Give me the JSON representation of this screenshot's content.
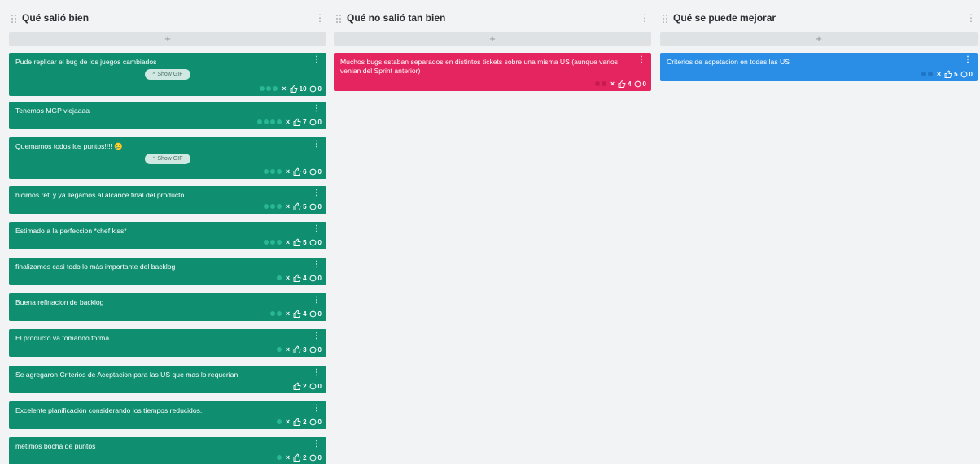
{
  "columns": [
    {
      "title": "Qué salió bien",
      "add_label": "+",
      "color": "#0f8f70",
      "cards": [
        {
          "text": "Pude replicar el bug de los juegos cambiados",
          "gif": "Show GIF",
          "dots": 3,
          "votes": "10",
          "comments": "0",
          "x": true
        },
        {
          "text": "Tenemos MGP viejaaaa",
          "dots": 4,
          "votes": "7",
          "comments": "0",
          "x": true
        },
        {
          "text": "Quemamos todos los puntos!!!! 🥲",
          "gif": "Show GIF",
          "dots": 3,
          "votes": "6",
          "comments": "0",
          "x": true
        },
        {
          "text": "hicimos refi y ya llegamos al alcance final del producto",
          "dots": 3,
          "votes": "5",
          "comments": "0",
          "x": true
        },
        {
          "text": "Estimado a la perfeccion *chef kiss*",
          "dots": 3,
          "votes": "5",
          "comments": "0",
          "x": true
        },
        {
          "text": "finalizamos casi todo lo más importante del backlog",
          "dots": 1,
          "votes": "4",
          "comments": "0",
          "x": true
        },
        {
          "text": "Buena refinacion de backlog",
          "dots": 2,
          "votes": "4",
          "comments": "0",
          "x": true
        },
        {
          "text": "El producto va tomando forma",
          "dots": 1,
          "votes": "3",
          "comments": "0",
          "x": true
        },
        {
          "text": "Se agregaron Criterios de Aceptacion para las US que mas lo requerian",
          "dots": 0,
          "votes": "2",
          "comments": "0",
          "x": false
        },
        {
          "text": "Excelente planificación considerando los tiempos reducidos.",
          "dots": 1,
          "votes": "2",
          "comments": "0",
          "x": true
        },
        {
          "text": "metimos bocha de puntos",
          "dots": 1,
          "votes": "2",
          "comments": "0",
          "x": true
        }
      ]
    },
    {
      "title": "Qué no salió tan bien",
      "add_label": "+",
      "color": "#e5255f",
      "cards": [
        {
          "text": "Muchos bugs estaban separados en distintos tickets sobre una misma US (aunque varios venian del Sprint anterior)",
          "dots": 2,
          "votes": "4",
          "comments": "0",
          "x": true
        }
      ]
    },
    {
      "title": "Qué se puede mejorar",
      "add_label": "+",
      "color": "#2b8ee6",
      "cards": [
        {
          "text": "Criterios de acpetacion en todas las US",
          "dots": 2,
          "votes": "5",
          "comments": "0",
          "x": true
        }
      ]
    }
  ],
  "icons": {
    "column_menu": "⋮",
    "card_menu": "⋮",
    "remove": "×",
    "gif_chevron": "^"
  }
}
